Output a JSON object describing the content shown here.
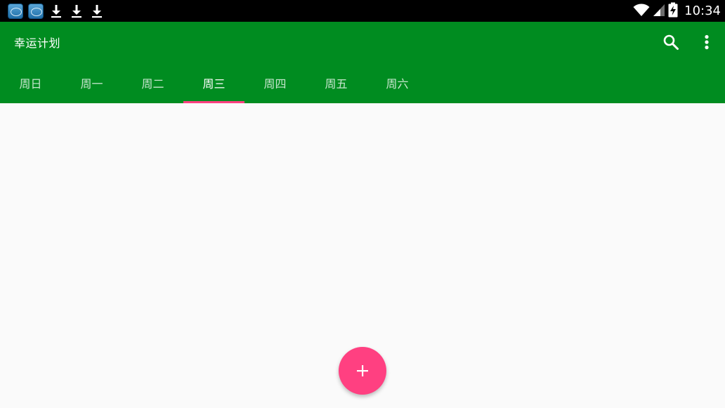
{
  "status_bar": {
    "time": "10:34",
    "icons": [
      "app-notification-icon",
      "app-notification-icon",
      "download-icon",
      "download-icon",
      "download-icon",
      "wifi-icon",
      "signal-icon",
      "battery-charging-icon"
    ]
  },
  "app_bar": {
    "title": "幸运计划",
    "background_color": "#008c20",
    "actions": [
      "search-icon",
      "more-vert-icon"
    ]
  },
  "tabs": {
    "items": [
      {
        "label": "周日"
      },
      {
        "label": "周一"
      },
      {
        "label": "周二"
      },
      {
        "label": "周三"
      },
      {
        "label": "周四"
      },
      {
        "label": "周五"
      },
      {
        "label": "周六"
      }
    ],
    "selected": "周三",
    "indicator_color": "#ff4081"
  },
  "fab": {
    "icon": "add-icon",
    "color": "#ff4081"
  }
}
